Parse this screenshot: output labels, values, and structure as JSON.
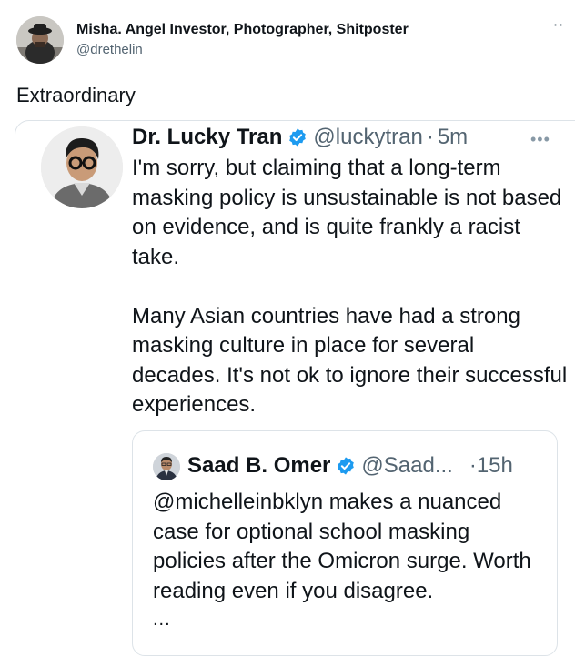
{
  "outer_tweet": {
    "author_name": "Misha. Angel Investor, Photographer, Shitposter",
    "author_handle": "@drethelin",
    "more_icon": "⋅⋅",
    "text": "Extraordinary"
  },
  "embedded_tweet": {
    "author_name": "Dr. Lucky Tran",
    "author_handle": "@luckytran",
    "separator": "·",
    "time": "5m",
    "more_icon": "•••",
    "paragraph_1": "I'm sorry, but claiming that a long-term masking policy is unsustainable is not based on evidence, and is quite frankly a racist take.",
    "paragraph_2": "Many Asian countries have had a strong masking culture in place for several decades. It's not ok to ignore their successful experiences.",
    "verified_icon": "verified-badge-icon",
    "colors": {
      "verified": "#1d9bf0",
      "secondary_text": "#536471",
      "border": "#dde3e8"
    }
  },
  "quoted_tweet": {
    "author_name": "Saad B. Omer",
    "author_handle": "@Saad...",
    "time": "·15h",
    "text": "@michelleinbklyn makes a nuanced case for optional school masking policies after the Omicron surge. Worth reading even if you disagree.",
    "ellipsis": "..."
  }
}
